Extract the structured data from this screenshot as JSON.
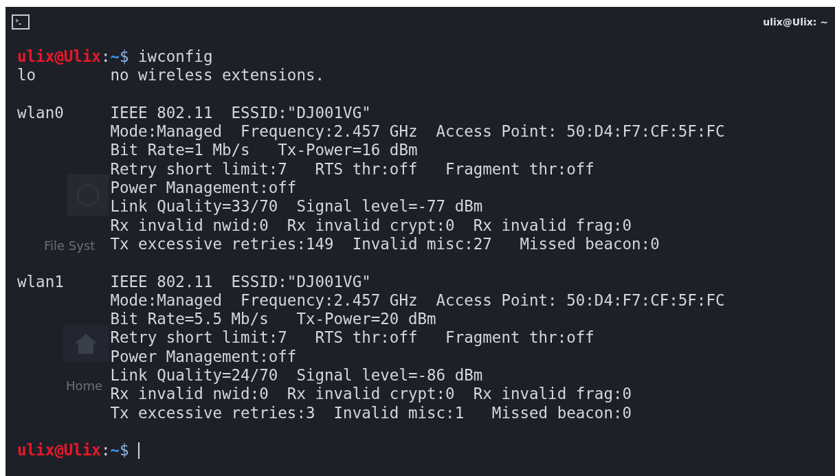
{
  "window": {
    "title": "ulix@Ulix: ~"
  },
  "desktop_icons": [
    {
      "kind": "drive",
      "label": "File Syst"
    },
    {
      "kind": "home",
      "label": "Home"
    }
  ],
  "terminal": {
    "sessions": [
      {
        "prompt": {
          "user_host": "ulix@Ulix",
          "separator": ":",
          "path": "~",
          "symbol": "$"
        },
        "command": "iwconfig",
        "output": [
          {
            "interface": "lo",
            "lines": [
              "no wireless extensions."
            ]
          },
          {
            "interface": "wlan0",
            "lines": [
              "IEEE 802.11  ESSID:\"DJ001VG\"",
              "Mode:Managed  Frequency:2.457 GHz  Access Point: 50:D4:F7:CF:5F:FC",
              "Bit Rate=1 Mb/s   Tx-Power=16 dBm",
              "Retry short limit:7   RTS thr:off   Fragment thr:off",
              "Power Management:off",
              "Link Quality=33/70  Signal level=-77 dBm",
              "Rx invalid nwid:0  Rx invalid crypt:0  Rx invalid frag:0",
              "Tx excessive retries:149  Invalid misc:27   Missed beacon:0"
            ]
          },
          {
            "interface": "wlan1",
            "lines": [
              "IEEE 802.11  ESSID:\"DJ001VG\"",
              "Mode:Managed  Frequency:2.457 GHz  Access Point: 50:D4:F7:CF:5F:FC",
              "Bit Rate=5.5 Mb/s   Tx-Power=20 dBm",
              "Retry short limit:7   RTS thr:off   Fragment thr:off",
              "Power Management:off",
              "Link Quality=24/70  Signal level=-86 dBm",
              "Rx invalid nwid:0  Rx invalid crypt:0  Rx invalid frag:0",
              "Tx excessive retries:3  Invalid misc:1   Missed beacon:0"
            ]
          }
        ]
      }
    ],
    "current_prompt": {
      "user_host": "ulix@Ulix",
      "separator": ":",
      "path": "~",
      "symbol": "$"
    },
    "cursor": true
  }
}
